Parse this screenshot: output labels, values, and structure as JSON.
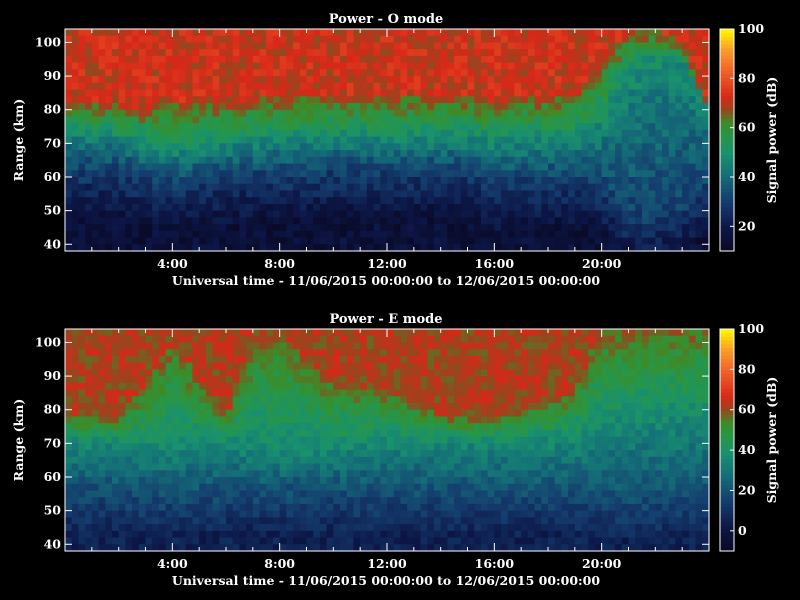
{
  "chart_data": [
    {
      "type": "heatmap",
      "title": "Power - O mode",
      "xlabel": "Universal time - 11/06/2015 00:00:00 to 12/06/2015 00:00:00",
      "ylabel": "Range (km)",
      "x_ticks": [
        "4:00",
        "8:00",
        "12:00",
        "16:00",
        "20:00"
      ],
      "x_range_hours": [
        0,
        24
      ],
      "y_ticks": [
        40,
        50,
        60,
        70,
        80,
        90,
        100
      ],
      "y_range": [
        38,
        104
      ],
      "colorbar": {
        "label": "Signal power (dB)",
        "ticks": [
          20,
          40,
          60,
          80,
          100
        ],
        "range": [
          10,
          100
        ]
      },
      "profile": {
        "hours": [
          0,
          2,
          3,
          4,
          6,
          8,
          10,
          12,
          14,
          15,
          16,
          17,
          19,
          20,
          21,
          22,
          23,
          24
        ],
        "floor_km": [
          62,
          62,
          59,
          58,
          60,
          61,
          62,
          62,
          62,
          62,
          57,
          59,
          59,
          57,
          48,
          48,
          50,
          58
        ],
        "mid_km": [
          74,
          72,
          70,
          68,
          70,
          72,
          72,
          72,
          72,
          72,
          71,
          72,
          72,
          76,
          90,
          95,
          95,
          80
        ],
        "top_km": [
          82,
          82,
          80,
          82,
          82,
          84,
          84,
          84,
          84,
          84,
          82,
          84,
          84,
          96,
          104,
          104,
          100,
          80
        ]
      },
      "levels_db": {
        "low": 15,
        "floor": 30,
        "mid": 48,
        "top": 68
      }
    },
    {
      "type": "heatmap",
      "title": "Power - E mode",
      "xlabel": "Universal time - 11/06/2015 00:00:00 to 12/06/2015 00:00:00",
      "ylabel": "Range (km)",
      "x_ticks": [
        "4:00",
        "8:00",
        "12:00",
        "16:00",
        "20:00"
      ],
      "x_range_hours": [
        0,
        24
      ],
      "y_ticks": [
        40,
        50,
        60,
        70,
        80,
        90,
        100
      ],
      "y_range": [
        38,
        104
      ],
      "colorbar": {
        "label": "Signal power (dB)",
        "ticks": [
          0,
          20,
          40,
          60,
          80,
          100
        ],
        "range": [
          -10,
          100
        ]
      },
      "profile": {
        "hours": [
          0,
          2,
          3,
          4,
          6,
          7,
          8,
          10,
          12,
          14,
          16,
          17,
          19,
          20,
          22,
          24
        ],
        "floor_km": [
          57,
          57,
          56,
          56,
          57,
          57,
          57,
          57,
          57,
          57,
          57,
          57,
          56,
          55,
          55,
          56
        ],
        "mid_km": [
          70,
          70,
          68,
          68,
          70,
          68,
          67,
          68,
          70,
          70,
          70,
          70,
          70,
          74,
          76,
          76
        ],
        "top_km": [
          78,
          78,
          88,
          100,
          78,
          100,
          104,
          88,
          86,
          78,
          78,
          80,
          86,
          104,
          104,
          104
        ]
      },
      "levels_db": {
        "low": 5,
        "floor": 20,
        "mid": 35,
        "top": 58
      }
    }
  ]
}
